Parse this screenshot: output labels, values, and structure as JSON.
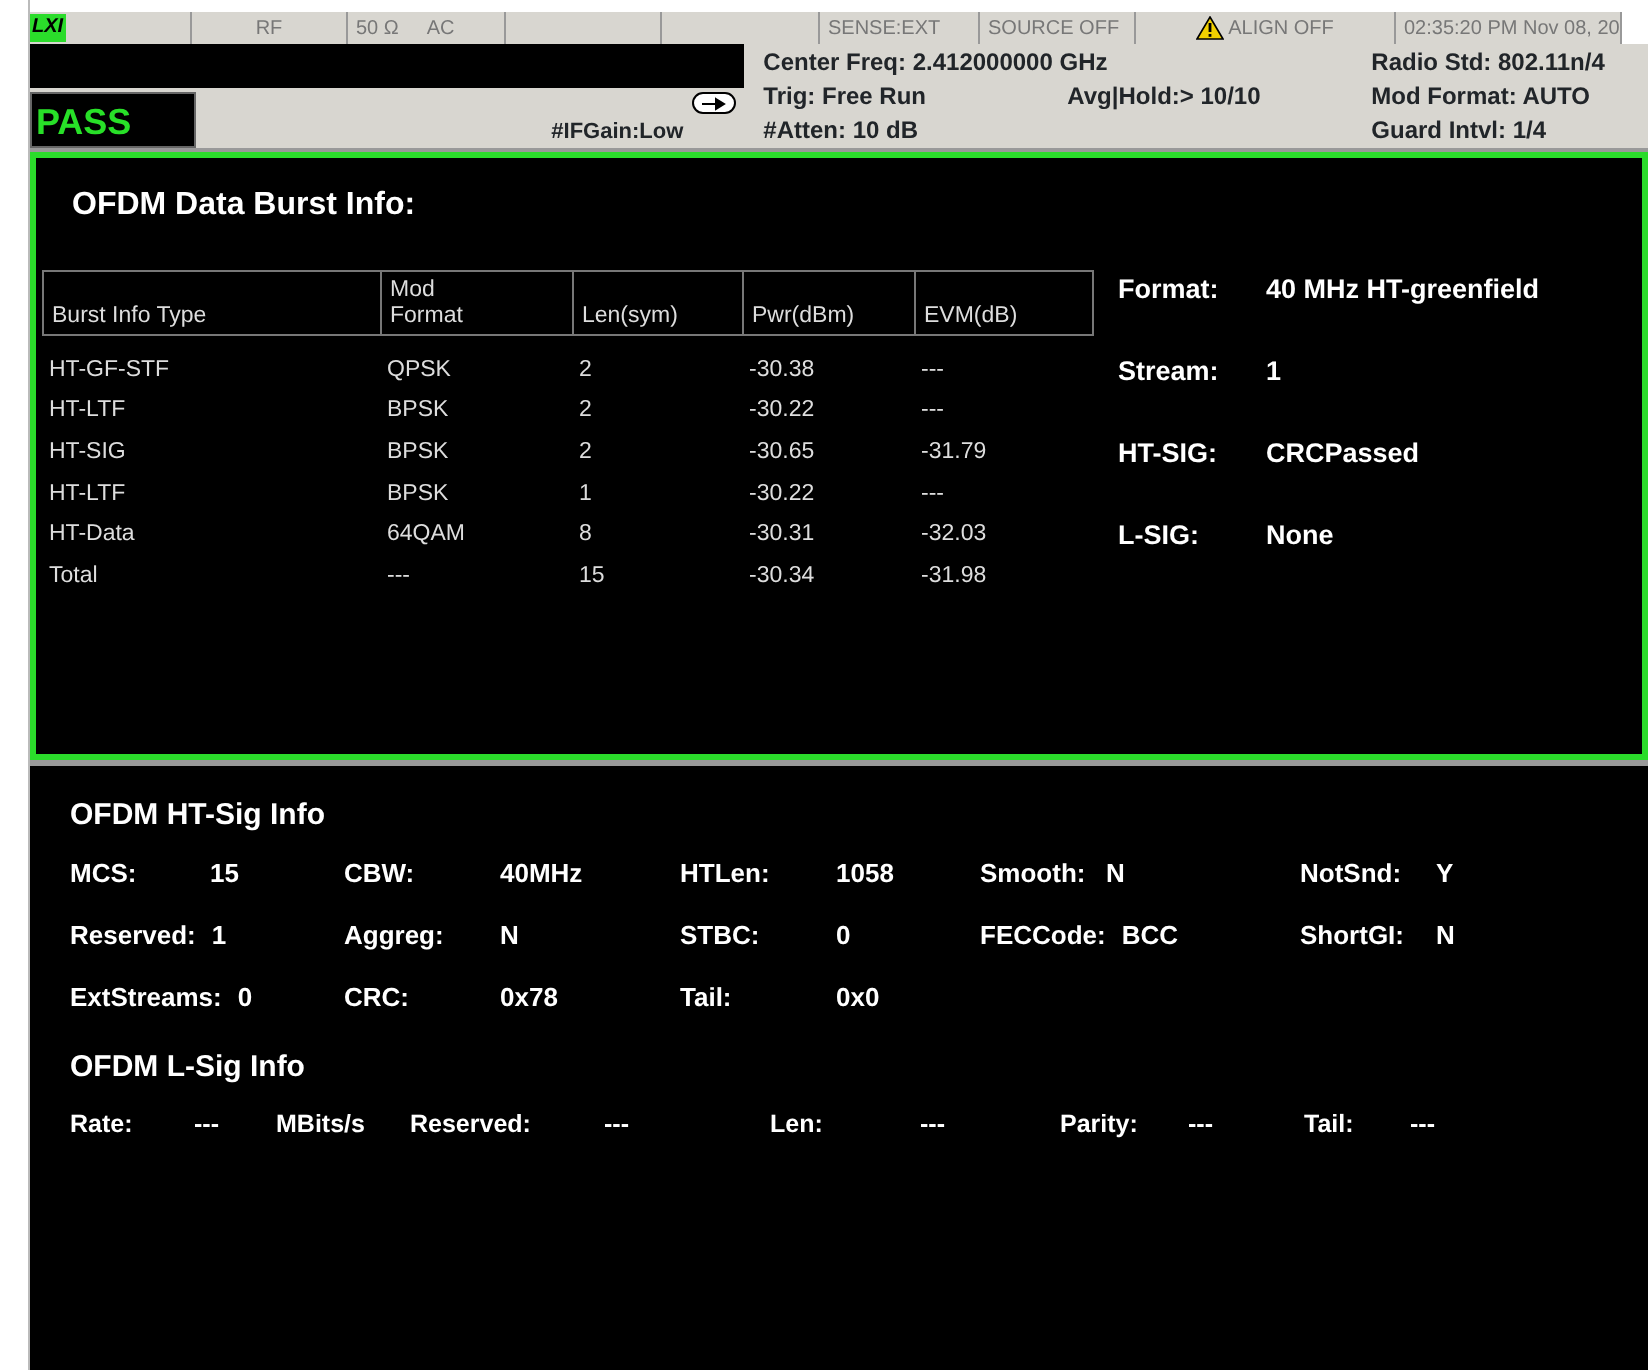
{
  "status_bar": {
    "cells": [
      {
        "kind": "logo",
        "text": "LXI"
      },
      {
        "kind": "text",
        "texts": [
          "RF"
        ]
      },
      {
        "kind": "text",
        "texts": [
          "50 Ω",
          "AC"
        ]
      },
      {
        "kind": "blank"
      },
      {
        "kind": "blank"
      },
      {
        "kind": "text",
        "texts": [
          "SENSE:EXT"
        ]
      },
      {
        "kind": "text",
        "texts": [
          "SOURCE OFF"
        ]
      },
      {
        "kind": "alert",
        "texts": [
          "ALIGN OFF"
        ]
      },
      {
        "kind": "text",
        "texts": [
          "02:35:20 PM Nov 08, 20"
        ]
      }
    ]
  },
  "header": {
    "result": "PASS",
    "if_gain": "#IFGain:Low",
    "settings": [
      {
        "column_1": "Center Freq: 2.412000000 GHz",
        "column_3": "Radio Std: 802.11n/4"
      },
      {
        "column_1": "Trig: Free Run",
        "column_2": "Avg|Hold:> 10/10",
        "column_3": "Mod Format: AUTO"
      },
      {
        "column_1": "#Atten: 10 dB",
        "column_3": "Guard Intvl: 1/4"
      }
    ]
  },
  "burst_panel": {
    "title": "OFDM Data Burst Info:",
    "table": {
      "columns": [
        "Burst Info Type",
        "Mod\nFormat",
        "Len(sym)",
        "Pwr(dBm)",
        "EVM(dB)"
      ],
      "rows": [
        [
          "HT-GF-STF",
          "QPSK",
          "2",
          "-30.38",
          "---"
        ],
        [
          "HT-LTF",
          "BPSK",
          "2",
          "-30.22",
          "---"
        ],
        [
          "HT-SIG",
          "BPSK",
          "2",
          "-30.65",
          "-31.79"
        ],
        [
          "HT-LTF",
          "BPSK",
          "1",
          "-30.22",
          "---"
        ],
        [
          "HT-Data",
          "64QAM",
          "8",
          "-30.31",
          "-32.03"
        ],
        [
          "Total",
          "---",
          "15",
          "-30.34",
          "-31.98"
        ]
      ]
    },
    "info": [
      {
        "label": "Format:",
        "value": "40 MHz HT-greenfield"
      },
      {
        "label": "Stream:",
        "value": "1"
      },
      {
        "label": "HT-SIG:",
        "value": "CRCPassed"
      },
      {
        "label": "L-SIG:",
        "value": "None"
      }
    ]
  },
  "ht_sig": {
    "title": "OFDM HT-Sig Info",
    "rows": [
      [
        {
          "label": "MCS:",
          "value": "15"
        },
        {
          "label": "CBW:",
          "value": "40MHz"
        },
        {
          "label": "HTLen:",
          "value": "1058"
        },
        {
          "label": "Smooth:",
          "value": "N"
        },
        {
          "label": "NotSnd:",
          "value": "Y"
        }
      ],
      [
        {
          "label": "Reserved:",
          "value": "1"
        },
        {
          "label": "Aggreg:",
          "value": "N"
        },
        {
          "label": "STBC:",
          "value": "0"
        },
        {
          "label": "FECCode:",
          "value": "BCC"
        },
        {
          "label": "ShortGI:",
          "value": "N"
        }
      ],
      [
        {
          "label": "ExtStreams:",
          "value": "0"
        },
        {
          "label": "CRC:",
          "value": "0x78"
        },
        {
          "label": "Tail:",
          "value": "0x0"
        }
      ]
    ]
  },
  "l_sig": {
    "title": "OFDM L-Sig Info",
    "items": [
      "Rate:",
      "---",
      "MBits/s",
      "Reserved:",
      "---",
      "Len:",
      "---",
      "Parity:",
      "---",
      "Tail:",
      "---"
    ]
  }
}
